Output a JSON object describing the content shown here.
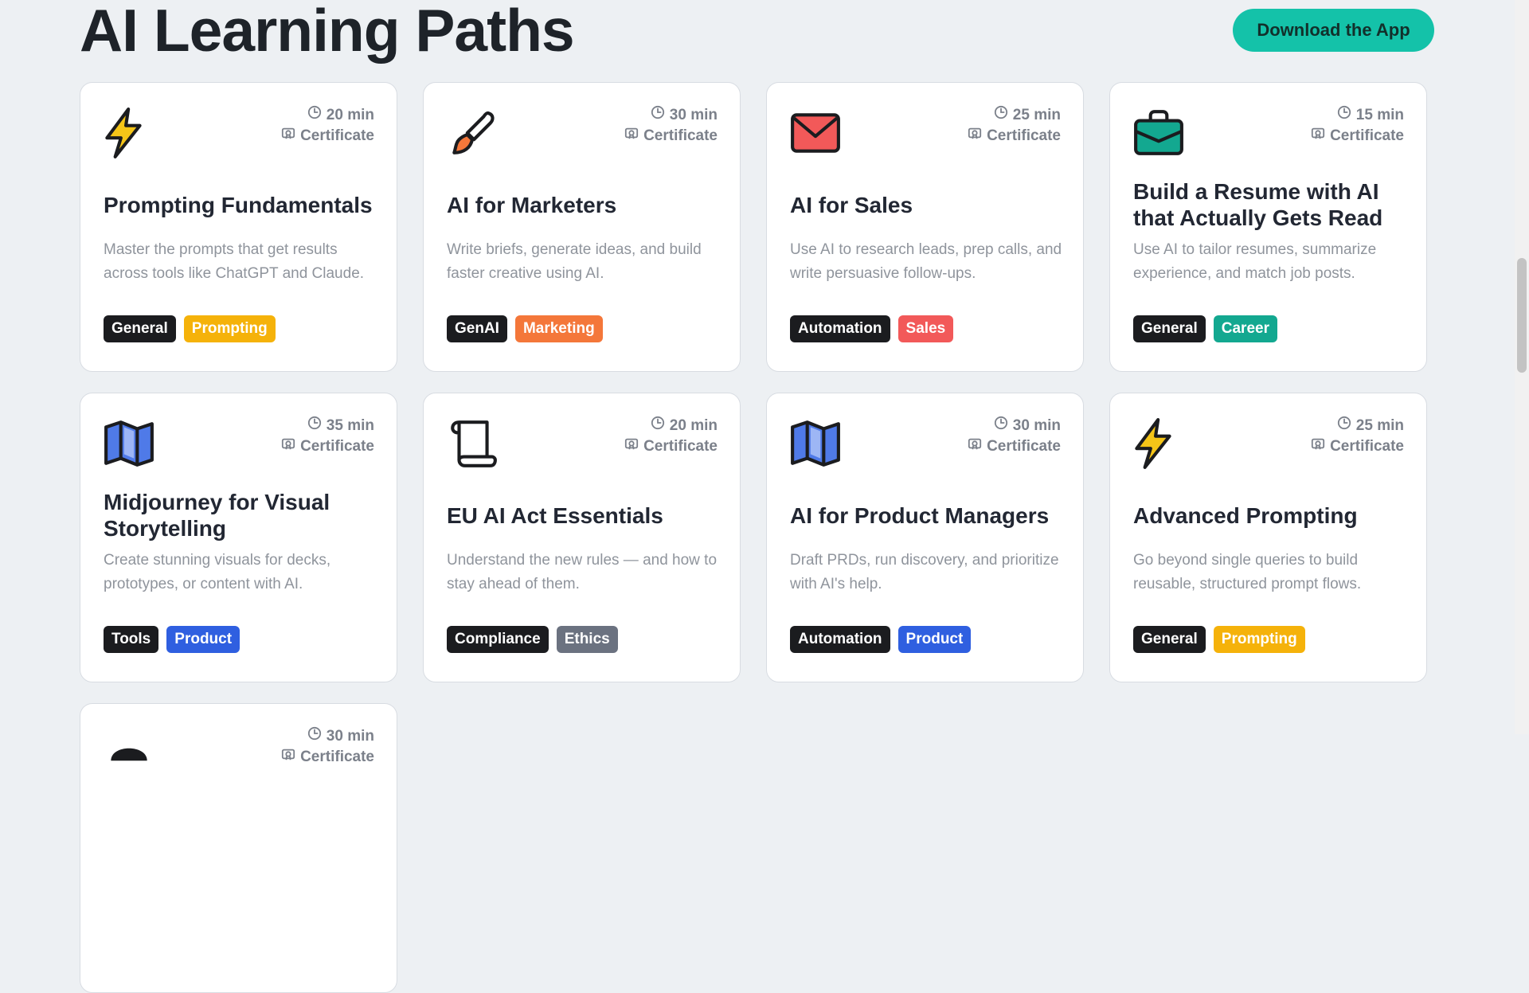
{
  "header": {
    "title": "AI Learning Paths",
    "download_label": "Download the App"
  },
  "meta_label": "Certificate",
  "colors": {
    "accent": "#14c2a9",
    "tag_dark": "#1b1c1f",
    "tag_yellow": "#f5b20a",
    "tag_orange": "#f4773a",
    "tag_red": "#f25959",
    "tag_teal": "#13a890",
    "tag_blue": "#2f5fe0",
    "tag_gray": "#6b7280"
  },
  "cards": [
    {
      "title": "Prompting Fundamentals",
      "duration": "20 min",
      "icon": "lightning-icon",
      "description": "Master the prompts that get results across tools like ChatGPT and Claude.",
      "tags": [
        {
          "label": "General",
          "color": "#1b1c1f"
        },
        {
          "label": "Prompting",
          "color": "#f5b20a"
        }
      ]
    },
    {
      "title": "AI for Marketers",
      "duration": "30 min",
      "icon": "paintbrush-icon",
      "description": "Write briefs, generate ideas, and build faster creative using AI.",
      "tags": [
        {
          "label": "GenAI",
          "color": "#1b1c1f"
        },
        {
          "label": "Marketing",
          "color": "#f4773a"
        }
      ]
    },
    {
      "title": "AI for Sales",
      "duration": "25 min",
      "icon": "envelope-icon",
      "description": "Use AI to research leads, prep calls, and write persuasive follow-ups.",
      "tags": [
        {
          "label": "Automation",
          "color": "#1b1c1f"
        },
        {
          "label": "Sales",
          "color": "#f25959"
        }
      ]
    },
    {
      "title": "Build a Resume with AI that Actually Gets Read",
      "duration": "15 min",
      "icon": "briefcase-icon",
      "description": "Use AI to tailor resumes, summarize experience, and match job posts.",
      "tags": [
        {
          "label": "General",
          "color": "#1b1c1f"
        },
        {
          "label": "Career",
          "color": "#13a890"
        }
      ]
    },
    {
      "title": "Midjourney for Visual Storytelling",
      "duration": "35 min",
      "icon": "map-icon",
      "description": "Create stunning visuals for decks, prototypes, or content with AI.",
      "tags": [
        {
          "label": "Tools",
          "color": "#1b1c1f"
        },
        {
          "label": "Product",
          "color": "#2f5fe0"
        }
      ]
    },
    {
      "title": "EU AI Act Essentials",
      "duration": "20 min",
      "icon": "scroll-icon",
      "description": "Understand the new rules — and how to stay ahead of them.",
      "tags": [
        {
          "label": "Compliance",
          "color": "#1b1c1f"
        },
        {
          "label": "Ethics",
          "color": "#6b7280"
        }
      ]
    },
    {
      "title": "AI for Product Managers",
      "duration": "30 min",
      "icon": "map-icon",
      "description": "Draft PRDs, run discovery, and prioritize with AI's help.",
      "tags": [
        {
          "label": "Automation",
          "color": "#1b1c1f"
        },
        {
          "label": "Product",
          "color": "#2f5fe0"
        }
      ]
    },
    {
      "title": "Advanced Prompting",
      "duration": "25 min",
      "icon": "lightning-icon",
      "description": "Go beyond single queries to build reusable, structured prompt flows.",
      "tags": [
        {
          "label": "General",
          "color": "#1b1c1f"
        },
        {
          "label": "Prompting",
          "color": "#f5b20a"
        }
      ]
    },
    {
      "title": "",
      "duration": "30 min",
      "icon": "",
      "description": "",
      "tags": []
    }
  ]
}
